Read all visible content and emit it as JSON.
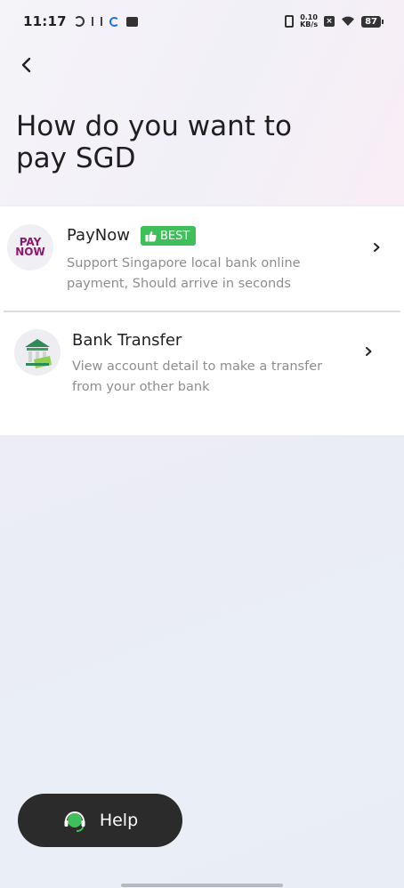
{
  "status_bar": {
    "time": "11:17",
    "net_speed_value": "0.10",
    "net_speed_unit": "KB/s",
    "battery": "87"
  },
  "header": {
    "title": "How do you want to pay SGD"
  },
  "options": [
    {
      "title": "PayNow",
      "badge": "BEST",
      "description": "Support Singapore local bank online payment, Should arrive in seconds",
      "logo_line1": "PAY",
      "logo_line2": "NOW",
      "logo_color": "#8b1b6b"
    },
    {
      "title": "Bank Transfer",
      "description": "View account detail to make a transfer from your other bank",
      "logo_color": "#2e8b57"
    }
  ],
  "help": {
    "label": "Help"
  },
  "colors": {
    "badge": "#3fbf5a",
    "help_bg": "#2b2b2b"
  }
}
